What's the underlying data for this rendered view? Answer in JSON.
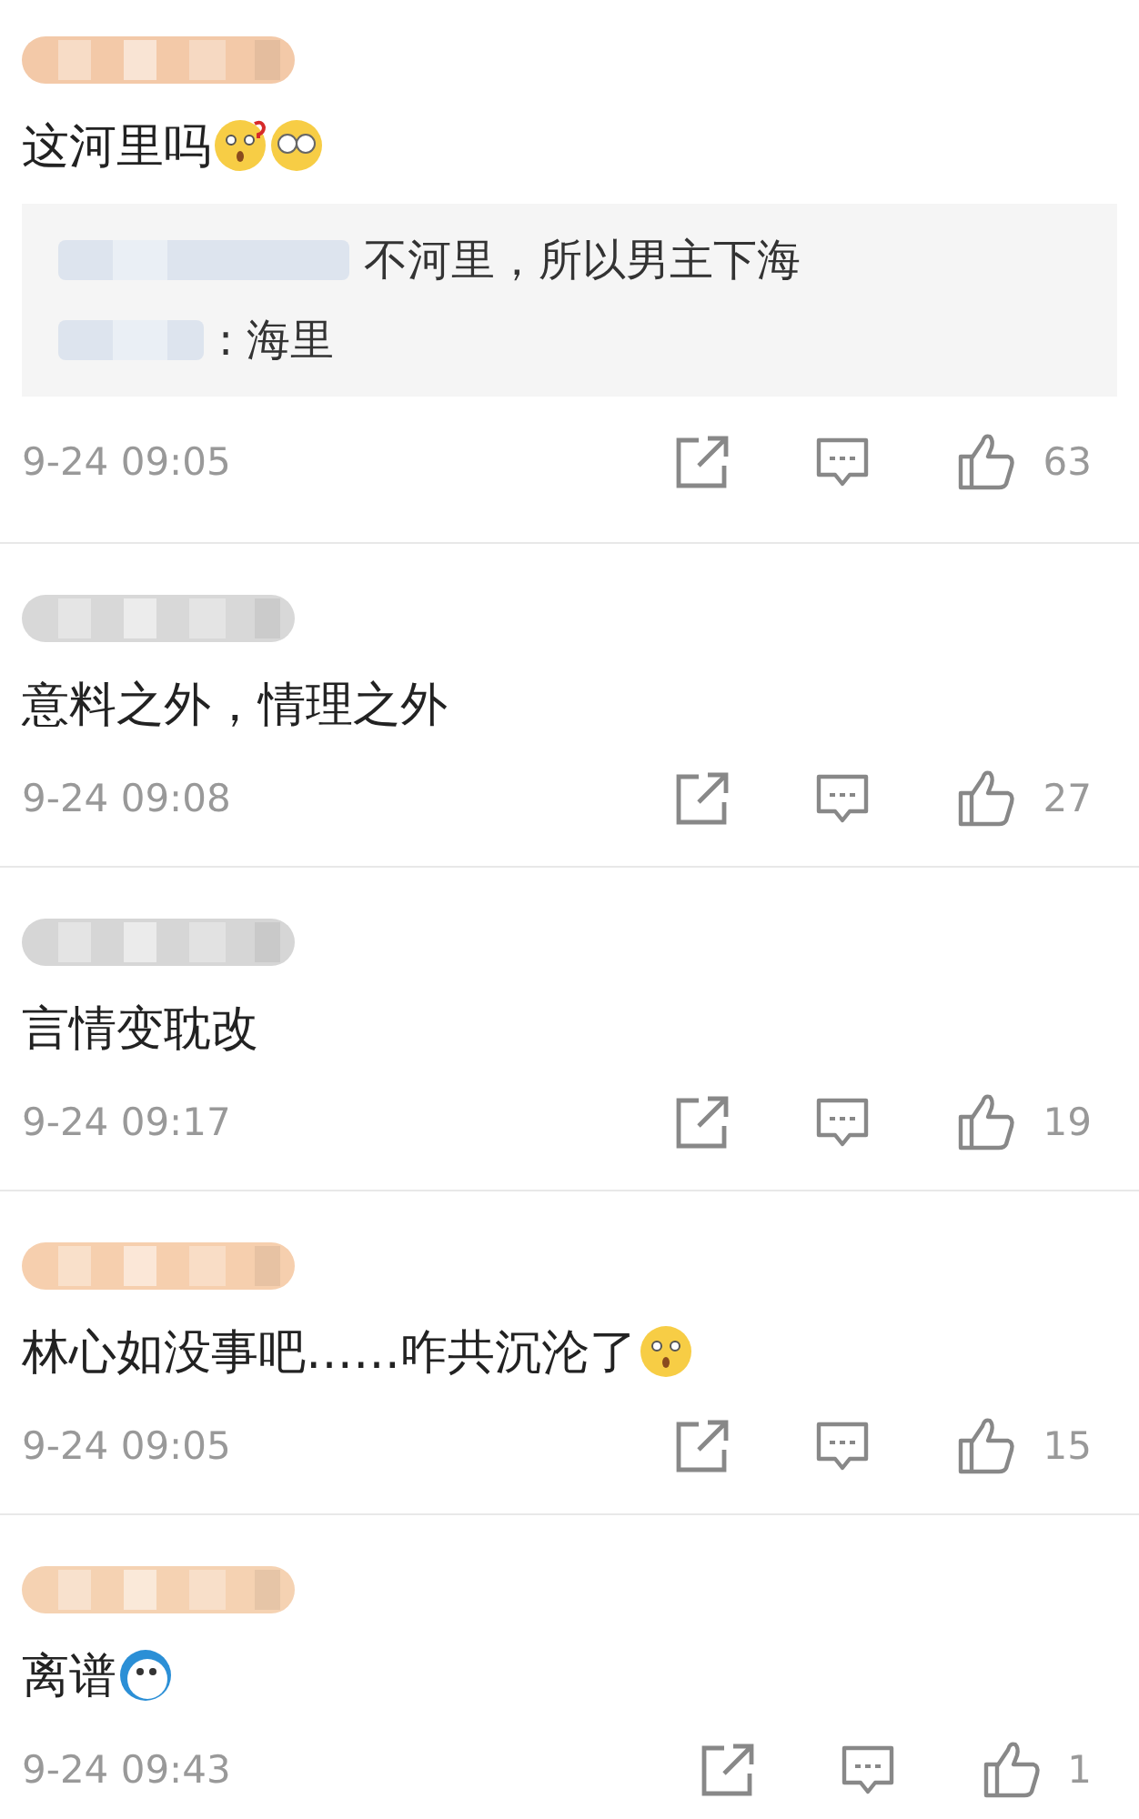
{
  "comments": [
    {
      "color": "#f3c9a8",
      "text": "这河里吗",
      "emojis": [
        {
          "kind": "puzzled"
        },
        {
          "kind": "glasses"
        }
      ],
      "replies": [
        {
          "text": "不河里，所以男主下海"
        },
        {
          "text": ": 海里"
        }
      ],
      "time": "9-24 09:05",
      "likes": "63"
    },
    {
      "color": "#d8d8d8",
      "text": "意料之外，情理之外",
      "time": "9-24 09:08",
      "likes": "27"
    },
    {
      "color": "#d6d6d6",
      "text": "言情变耽改",
      "time": "9-24 09:17",
      "likes": "19"
    },
    {
      "color": "#f6cfae",
      "text": "林心如没事吧……咋共沉沦了",
      "emojis": [
        {
          "kind": "shocked"
        }
      ],
      "time": "9-24 09:05",
      "likes": "15"
    },
    {
      "color": "#f5d2b2",
      "text": "离谱",
      "emojis": [
        {
          "kind": "mascot"
        }
      ],
      "time": "9-24 09:43",
      "likes": "1"
    }
  ]
}
